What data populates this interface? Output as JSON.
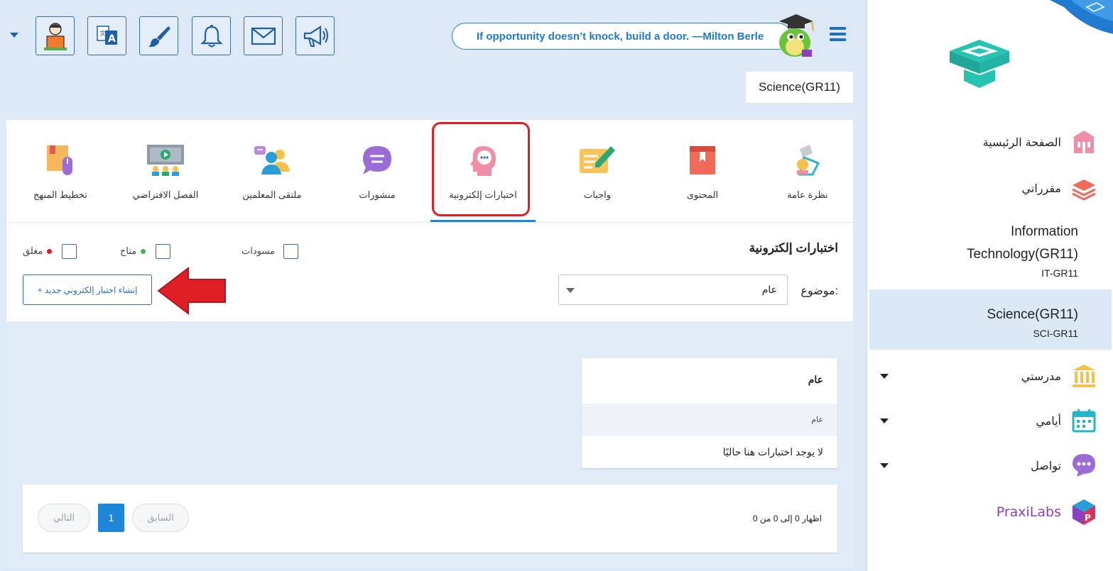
{
  "header": {
    "quote": "If opportunity doesn’t knock, build a door. —Milton Berle",
    "course_title": "Science(GR11)"
  },
  "toolbar": {
    "icons": [
      "profile-icon",
      "translate-icon",
      "brush-icon",
      "bell-icon",
      "mail-icon",
      "megaphone-icon"
    ]
  },
  "tabs": [
    {
      "label": "نظرة عامة",
      "icon": "overview-icon"
    },
    {
      "label": "المحتوى",
      "icon": "content-book-icon"
    },
    {
      "label": "واجبات",
      "icon": "assignments-icon"
    },
    {
      "label": "اختبارات إلكترونية",
      "icon": "quiz-head-icon",
      "active": true
    },
    {
      "label": "منشورات",
      "icon": "posts-bubble-icon"
    },
    {
      "label": "ملتقى المعلمين",
      "icon": "teachers-forum-icon"
    },
    {
      "label": "الفصل الافتراضي",
      "icon": "virtual-class-icon"
    },
    {
      "label": "تخطيط المنهج",
      "icon": "curriculum-planning-icon"
    }
  ],
  "section": {
    "title": "اختبارات إلكترونية",
    "legend": {
      "drafts": "مسودات",
      "available": "متاح",
      "closed": "مغلق"
    },
    "topic_label": "موضوع:",
    "topic_value": "عام",
    "create_button": "+ إنشاء اختبار إلكتروني جديد"
  },
  "quiz_card": {
    "heading": "عام",
    "subheading": "عام",
    "empty_message": "لا يوجد اختبارات هنا حاليًا"
  },
  "pagination": {
    "info": "اظهار 0 إلى 0 من 0",
    "prev": "السابق",
    "current": "1",
    "next": "التالي"
  },
  "sidebar": {
    "home": "الصفحة الرئيسية",
    "my_courses": "مقرراتي",
    "courses": [
      {
        "name_line1": "Information",
        "name_line2": "Technology(GR11)",
        "code": "IT-GR11"
      },
      {
        "name_line1": "Science(GR11)",
        "name_line2": "",
        "code": "SCI-GR11",
        "active": true
      }
    ],
    "school": "مدرستي",
    "days": "أيامي",
    "communicate": "تواصل",
    "praxilabs": "PraxiLabs"
  },
  "colors": {
    "accent": "#1e86d6",
    "highlight": "#e01e25",
    "available_dot": "#4caf50",
    "closed_dot": "#e01e25"
  }
}
